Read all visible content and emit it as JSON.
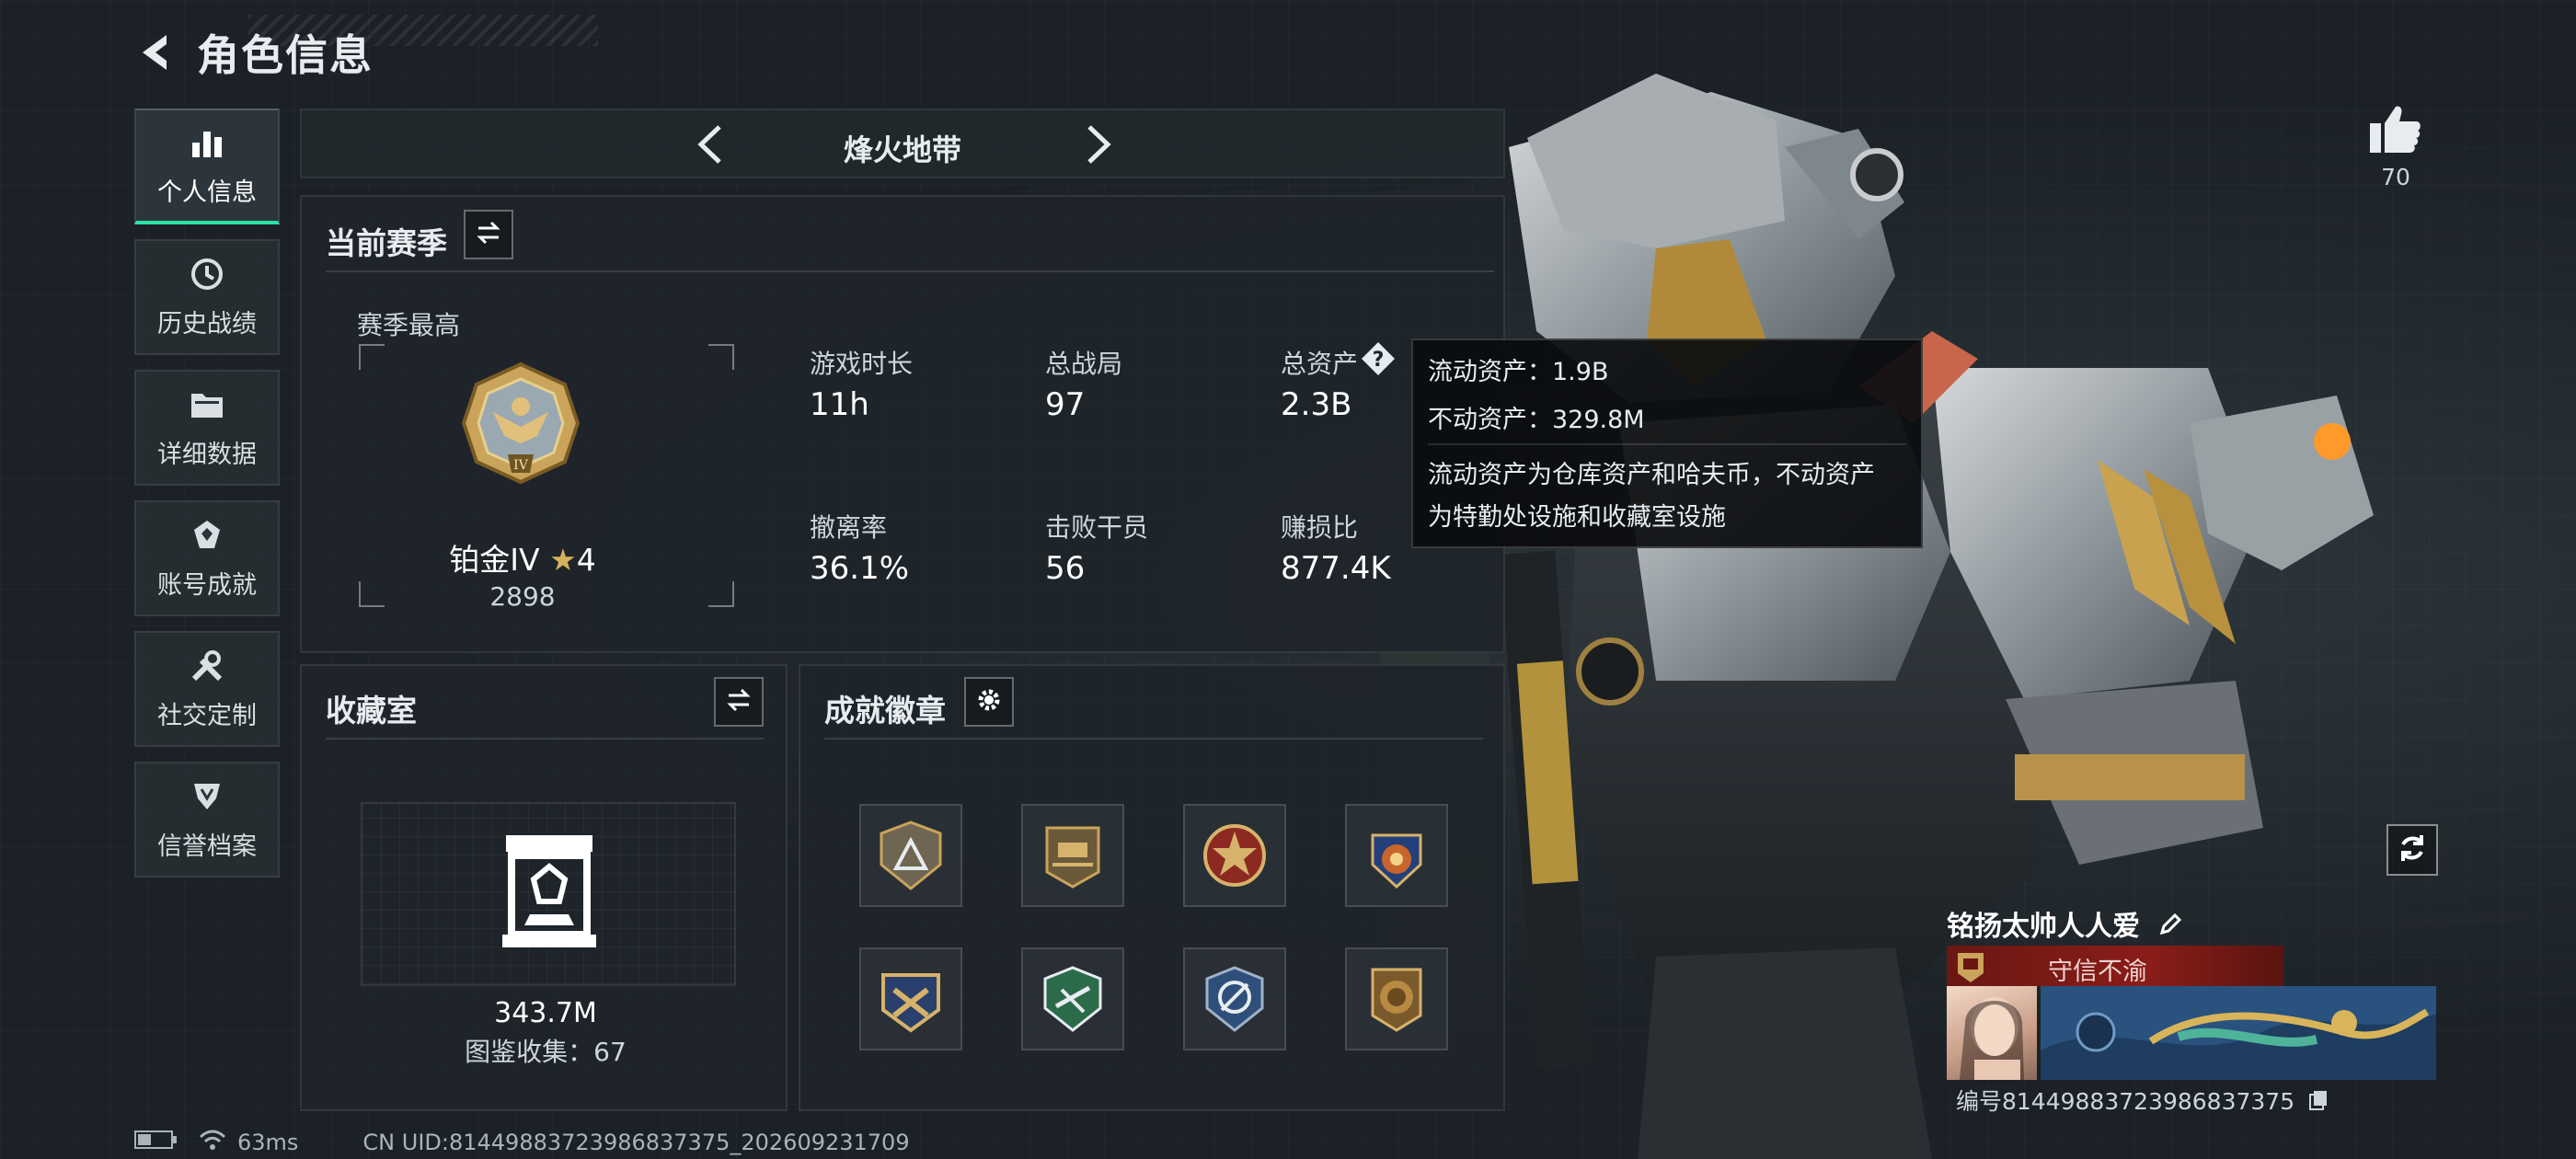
{
  "header": {
    "title": "角色信息"
  },
  "sidebar": {
    "items": [
      {
        "label": "个人信息",
        "icon": "bar-chart-icon",
        "active": true
      },
      {
        "label": "历史战绩",
        "icon": "clock-icon"
      },
      {
        "label": "详细数据",
        "icon": "folder-icon"
      },
      {
        "label": "账号成就",
        "icon": "achievement-icon"
      },
      {
        "label": "社交定制",
        "icon": "wrench-icon"
      },
      {
        "label": "信誉档案",
        "icon": "shield-icon"
      }
    ]
  },
  "mode": {
    "name": "烽火地带"
  },
  "season": {
    "title": "当前赛季",
    "best_label": "赛季最高",
    "rank_name": "铂金IV",
    "rank_stars": "4",
    "rank_score": "2898",
    "stats": [
      {
        "label": "游戏时长",
        "value": "11h"
      },
      {
        "label": "总战局",
        "value": "97"
      },
      {
        "label": "总资产",
        "value": "2.3B"
      },
      {
        "label": "撤离率",
        "value": "36.1%"
      },
      {
        "label": "击败干员",
        "value": "56"
      },
      {
        "label": "赚损比",
        "value": "877.4K"
      }
    ]
  },
  "tooltip": {
    "liquid": "流动资产：1.9B",
    "fixed": "不动资产：329.8M",
    "desc_line1": "流动资产为仓库资产和哈夫币，不动资产",
    "desc_line2": "为特勤处设施和收藏室设施"
  },
  "collection": {
    "title": "收藏室",
    "value": "343.7M",
    "catalog": "图鉴收集：67"
  },
  "achievements": {
    "title": "成就徽章",
    "badges": [
      "badge-1",
      "badge-2",
      "badge-3",
      "badge-4",
      "badge-5",
      "badge-6",
      "badge-7",
      "badge-8"
    ]
  },
  "like": {
    "count": "70"
  },
  "profile": {
    "name": "铭扬太帅人人爱",
    "honor": "守信不渝",
    "uid": "编号8144988372398683737​5"
  },
  "status": {
    "ping": "63ms",
    "uid_line": "CN UID:81449883723986837375_202609231709"
  },
  "colors": {
    "accent": "#2fe0a5",
    "honor_red": "#8a1d18",
    "gold": "#c9a45a"
  }
}
